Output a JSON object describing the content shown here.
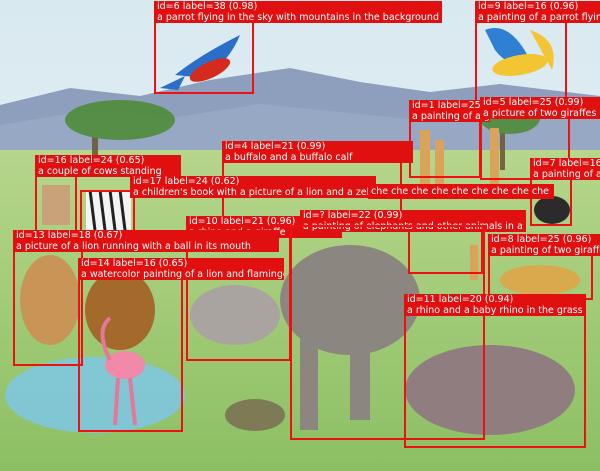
{
  "image": {
    "description_colors": {
      "sky": "#cfe3ec",
      "mountains": "#7b8fb0",
      "grass": "#9fc97a",
      "pond": "#7fc7df",
      "box": "#ee1111"
    }
  },
  "detections": [
    {
      "id_label": "id=6 label=38 (0.98)",
      "caption": "a parrot flying in the sky with mountains in the background"
    },
    {
      "id_label": "id=9 label=16 (0.96)",
      "caption": "a painting of a parrot flying"
    },
    {
      "id_label": "id=1 label=25 (0.99)",
      "caption": "a painting of a giraffe"
    },
    {
      "id_label": "id=5 label=25 (0.99)",
      "caption": "a picture of two giraffes in a field"
    },
    {
      "id_label": "id=4 label=21 (0.99)",
      "caption": "a buffalo and a buffalo calf"
    },
    {
      "id_label": "id=16 label=24 (0.65)",
      "caption": "a couple of cows standing"
    },
    {
      "id_label": "id=17 label=24 (0.62)",
      "caption": "a children's book with a picture of a lion and a zebra"
    },
    {
      "id_label": "id=7 label=16",
      "caption": "a painting of an ostrich and a rose bird standing"
    },
    {
      "id_label": "",
      "caption": "che che che che che che che che che"
    },
    {
      "id_label": "id=10 label=21 (0.96)",
      "caption": "a rhino and a giraffe"
    },
    {
      "id_label": "id=? label=22 (0.99)",
      "caption": "a painting of elephants and other animals in a field"
    },
    {
      "id_label": "id=13 label=18 (0.67)",
      "caption": "a picture of a lion running with a ball in its mouth"
    },
    {
      "id_label": "id=8 label=25 (0.96)",
      "caption": "a painting of two giraffes and a cheetah"
    },
    {
      "id_label": "id=14 label=16 (0.65)",
      "caption": "a watercolor painting of a lion and flamingo"
    },
    {
      "id_label": "id=11 label=20 (0.94)",
      "caption": "a rhino and a baby rhino in the grass"
    }
  ]
}
